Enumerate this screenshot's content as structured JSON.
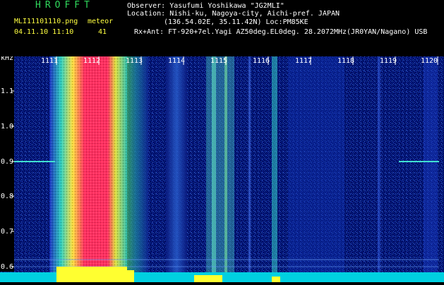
{
  "header": {
    "logo": "HROFFT",
    "filename": "MLI11101110.png",
    "mode": "meteor",
    "datetime": "04.11.10 11:10",
    "count": "41",
    "observer_line": "Observer: Yasufumi Yoshikawa \"JG2MLI\"",
    "location_line": "Location: Nishi-ku, Nagoya-city, Aichi-pref. JAPAN",
    "coord_line": "(136.54.02E, 35.11.42N) Loc:PM85KE",
    "rx_line": "Rx+Ant: FT-920+7el.Yagi AZ50deg.EL0deg. 28.2072MHz(JR0YAN/Nagano) USB"
  },
  "axis": {
    "unit": "kHz",
    "y_ticks": [
      "1.1",
      "1.0",
      "0.9",
      "0.8",
      "0.7",
      "0.6"
    ],
    "x_ticks": [
      "1111",
      "1112",
      "1113",
      "1114",
      "1115",
      "1116",
      "1117",
      "1118",
      "1119",
      "1120"
    ]
  },
  "colors": {
    "background": "#000000",
    "logo": "#2fd85c",
    "header_text": "#ffffff",
    "accent": "#ffff40",
    "spectrum_low": "#00007f",
    "spectrum_mid": "#00c8c8",
    "spectrum_high": "#ff3060"
  }
}
